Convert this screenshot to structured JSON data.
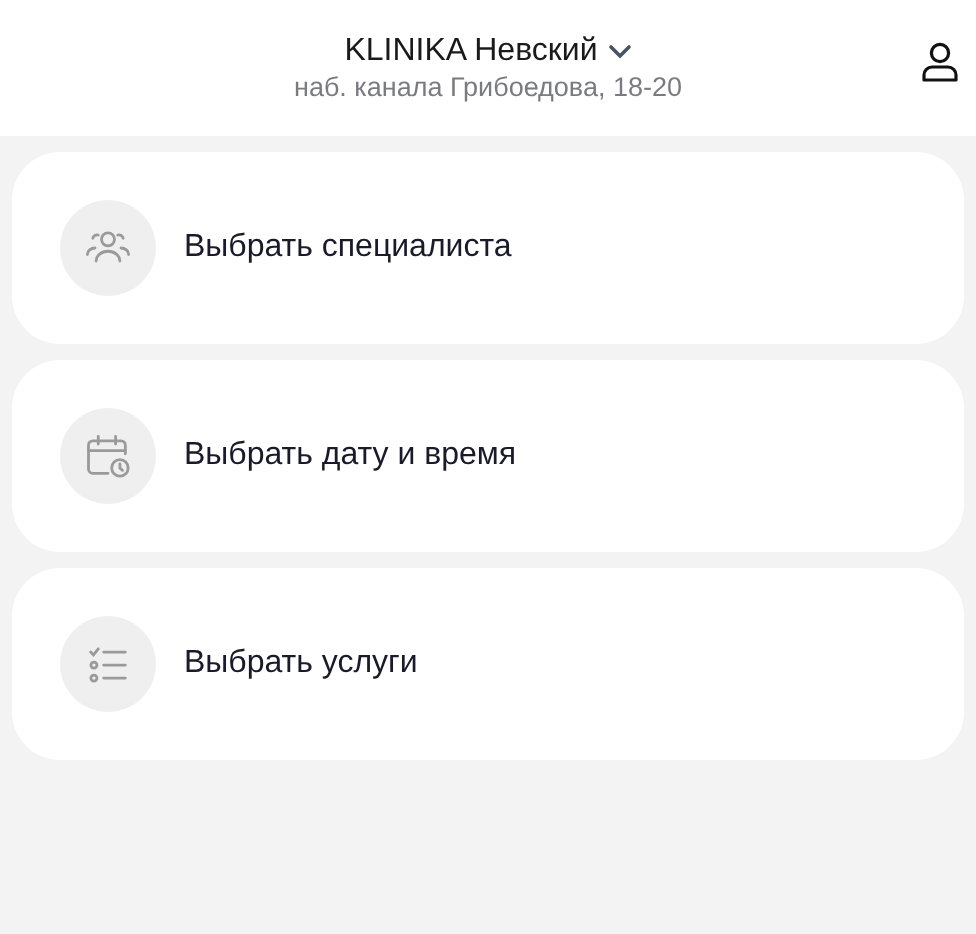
{
  "header": {
    "clinic": "KLINIKA Невский",
    "address": "наб. канала Грибоедова, 18-20"
  },
  "options": [
    {
      "kind": "specialist",
      "label": "Выбрать специалиста"
    },
    {
      "kind": "datetime",
      "label": "Выбрать дату и время"
    },
    {
      "kind": "services",
      "label": "Выбрать услуги"
    }
  ]
}
